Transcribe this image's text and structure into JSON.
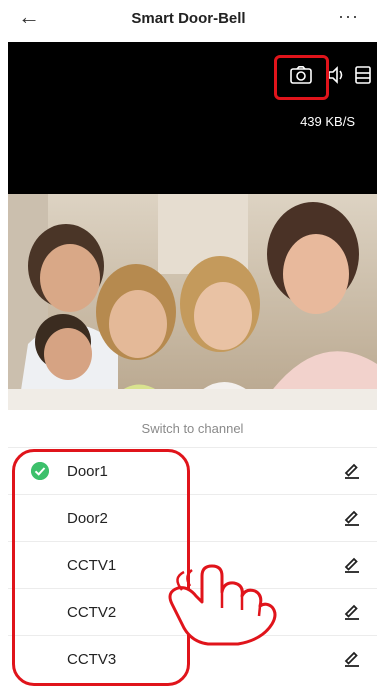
{
  "header": {
    "back_icon": "arrow-left-icon",
    "title": "Smart Door-Bell",
    "more_icon": "more-horizontal-icon"
  },
  "video": {
    "bitrate": "439 KB/S",
    "controls": [
      "camera-snapshot-icon",
      "speaker-icon",
      "layout-icon"
    ]
  },
  "channel_sheet": {
    "header": "Switch to channel",
    "channels": [
      {
        "label": "Door1",
        "selected": true
      },
      {
        "label": "Door2",
        "selected": false
      },
      {
        "label": "CCTV1",
        "selected": false
      },
      {
        "label": "CCTV2",
        "selected": false
      },
      {
        "label": "CCTV3",
        "selected": false
      }
    ],
    "edit_icon": "pencil-icon",
    "check_icon": "check-circle-icon"
  },
  "colors": {
    "annotation_red": "#e0141b",
    "selected_green": "#3cc06b",
    "video_background": "#000000"
  }
}
